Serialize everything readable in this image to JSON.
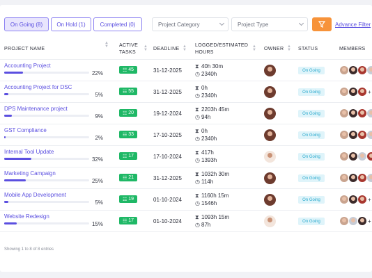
{
  "tabs": [
    {
      "label": "On Going (8)"
    },
    {
      "label": "On Hold (1)"
    },
    {
      "label": "Completed (0)"
    }
  ],
  "filters": {
    "category": "Project Category",
    "type": "Project Type",
    "advance": "Advance Filter"
  },
  "columns": {
    "name": "PROJECT NAME",
    "tasks_1": "ACTIVE",
    "tasks_2": "TASKS",
    "deadline": "DEADLINE",
    "logged_1": "LOGGED/ESTIMATED",
    "logged_2": "HOURS",
    "owner": "OWNER",
    "status": "STATUS",
    "members": "MEMBERS"
  },
  "rows": [
    {
      "name": "Accounting Project",
      "progress": 22,
      "pct": "22%",
      "tasks": "45",
      "deadline": "31-12-2025",
      "logged": "40h 30m",
      "estimated": "2340h",
      "status": "On Going",
      "owner": "female"
    },
    {
      "name": "Accounting Project for DSC",
      "progress": 5,
      "pct": "5%",
      "tasks": "55",
      "deadline": "31-12-2025",
      "logged": "0h",
      "estimated": "2340h",
      "status": "On Going",
      "owner": "female"
    },
    {
      "name": "DPS Maintenance project",
      "progress": 9,
      "pct": "9%",
      "tasks": "20",
      "deadline": "19-12-2024",
      "logged": "2203h 45m",
      "estimated": "94h",
      "status": "On Going",
      "owner": "female"
    },
    {
      "name": "GST Compliance",
      "progress": 2,
      "pct": "2%",
      "tasks": "33",
      "deadline": "17-10-2025",
      "logged": "0h",
      "estimated": "2340h",
      "status": "On Going",
      "owner": "female"
    },
    {
      "name": "Internal Tool Update",
      "progress": 32,
      "pct": "32%",
      "tasks": "17",
      "deadline": "17-10-2024",
      "logged": "417h",
      "estimated": "1393h",
      "status": "On Going",
      "owner": "male"
    },
    {
      "name": "Marketing Campaign",
      "progress": 25,
      "pct": "25%",
      "tasks": "21",
      "deadline": "31-12-2025",
      "logged": "1032h 30m",
      "estimated": "114h",
      "status": "On Going",
      "owner": "female"
    },
    {
      "name": "Mobile App Development",
      "progress": 5,
      "pct": "5%",
      "tasks": "19",
      "deadline": "01-10-2024",
      "logged": "1160h 15m",
      "estimated": "1546h",
      "status": "On Going",
      "owner": "female"
    },
    {
      "name": "Website Redesign",
      "progress": 15,
      "pct": "15%",
      "tasks": "17",
      "deadline": "01-10-2024",
      "logged": "1093h 15m",
      "estimated": "87h",
      "status": "On Going",
      "owner": "male"
    }
  ],
  "footer": "Showing 1 to 8 of 8 entries",
  "icons": {
    "hourglass": "⧗",
    "clock": "◷",
    "filter": "filter-icon",
    "task": "task-list-icon"
  },
  "colors": {
    "accent": "#5b4fe0",
    "filter_button": "#f7933a",
    "task_badge": "#1fb866",
    "status_badge": "#dff4fa"
  }
}
